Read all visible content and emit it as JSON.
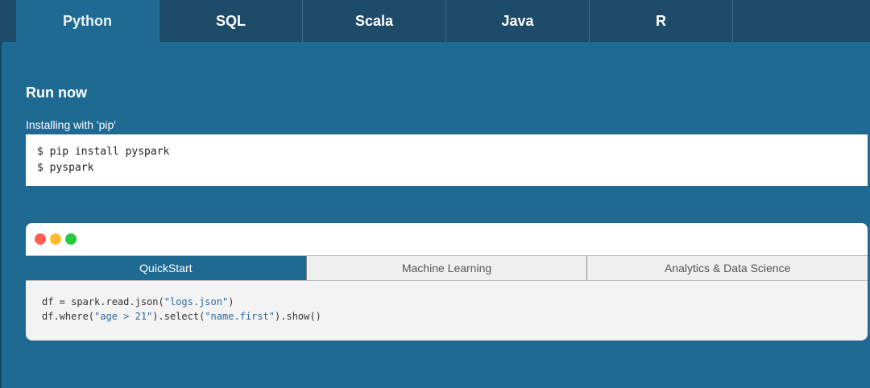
{
  "lang_tabs": {
    "items": [
      {
        "label": "Python",
        "active": true
      },
      {
        "label": "SQL",
        "active": false
      },
      {
        "label": "Scala",
        "active": false
      },
      {
        "label": "Java",
        "active": false
      },
      {
        "label": "R",
        "active": false
      }
    ]
  },
  "run_now": {
    "title": "Run now",
    "install_label": "Installing with 'pip'",
    "commands": [
      "$ pip install pyspark",
      "$ pyspark"
    ]
  },
  "example_window": {
    "tabs": [
      {
        "label": "QuickStart",
        "active": true
      },
      {
        "label": "Machine Learning",
        "active": false
      },
      {
        "label": "Analytics & Data Science",
        "active": false
      }
    ],
    "code": {
      "line1": {
        "pre": "df = spark.read.json(",
        "str": "\"logs.json\"",
        "post": ")"
      },
      "line2": {
        "pre": "df.where(",
        "str1": "\"age > 21\"",
        "mid": ").select(",
        "str2": "\"name.first\"",
        "post": ").show()"
      }
    }
  },
  "colors": {
    "background": "#1e6a93",
    "tab_bar": "#1d4b69",
    "string_literal": "#2a6aa5",
    "dot_red": "#ff5f57",
    "dot_yellow": "#febc2e",
    "dot_green": "#28c840"
  }
}
